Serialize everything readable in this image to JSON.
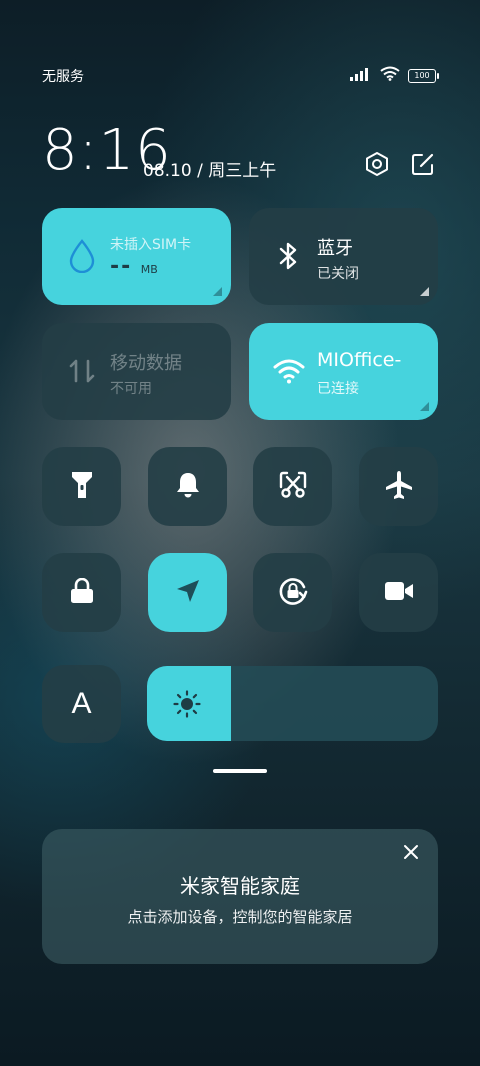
{
  "status_bar": {
    "carrier": "无服务",
    "battery": "100"
  },
  "header": {
    "time": "8:16",
    "date": "08.10 / 周三上午"
  },
  "tiles": {
    "sim": {
      "title": "未插入SIM卡",
      "value": "--",
      "unit": "MB",
      "state": "on"
    },
    "bluetooth": {
      "title": "蓝牙",
      "status": "已关闭",
      "state": "off"
    },
    "mobile_data": {
      "title": "移动数据",
      "status": "不可用",
      "state": "disabled"
    },
    "wifi": {
      "title": "MIOffice-",
      "status": "已连接",
      "state": "on"
    }
  },
  "toggles": [
    {
      "icon": "flashlight-icon",
      "state": "off"
    },
    {
      "icon": "bell-icon",
      "state": "off"
    },
    {
      "icon": "screenshot-icon",
      "state": "off"
    },
    {
      "icon": "airplane-icon",
      "state": "off"
    },
    {
      "icon": "lock-icon",
      "state": "off"
    },
    {
      "icon": "location-icon",
      "state": "on"
    },
    {
      "icon": "rotation-lock-icon",
      "state": "off"
    },
    {
      "icon": "video-camera-icon",
      "state": "off"
    }
  ],
  "auto_brightness_label": "A",
  "brightness_level": 0.29,
  "colors": {
    "accent": "#46d3dd",
    "tile_off": "#233e46"
  },
  "mijia_card": {
    "title": "米家智能家庭",
    "subtitle": "点击添加设备，控制您的智能家居"
  }
}
